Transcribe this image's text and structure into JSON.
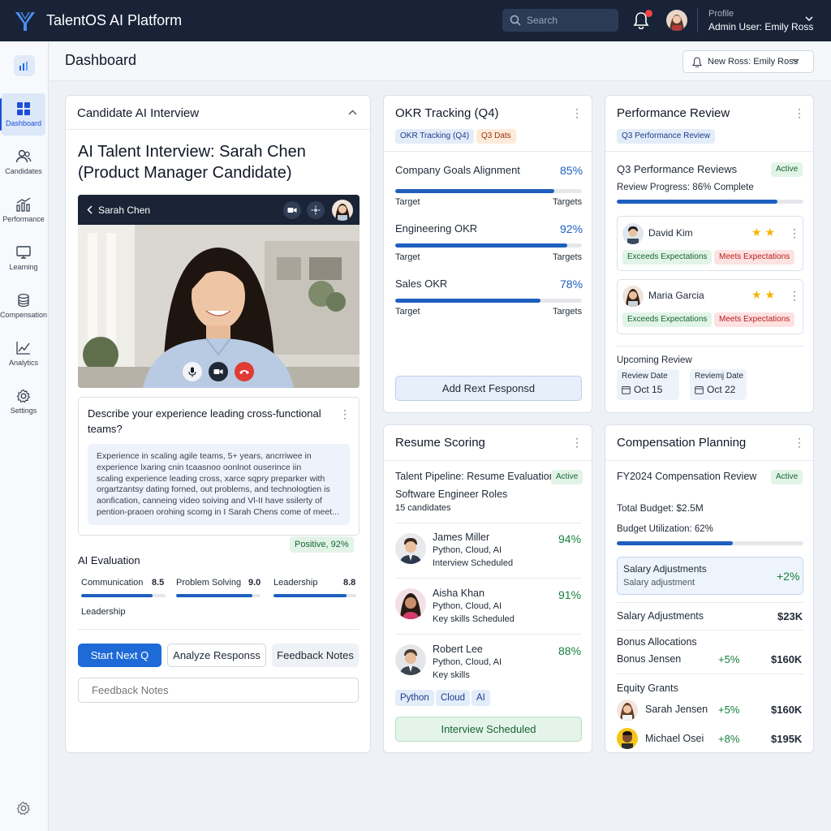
{
  "app": {
    "title": "TalentOS AI Platform"
  },
  "topbar": {
    "search_placeholder": "Search",
    "profile_label": "Profile",
    "profile_name": "Admin User: Emily Ross"
  },
  "sidebar": {
    "items": [
      {
        "label": "Dashboard",
        "icon": "dashboard-icon",
        "active": true
      },
      {
        "label": "Candidates",
        "icon": "users-icon"
      },
      {
        "label": "Performance",
        "icon": "chart-icon"
      },
      {
        "label": "Learning",
        "icon": "monitor-icon"
      },
      {
        "label": "Compensation",
        "icon": "coins-icon"
      },
      {
        "label": "Analytics",
        "icon": "line-chart-icon"
      },
      {
        "label": "Settings",
        "icon": "gear-icon"
      }
    ]
  },
  "header": {
    "title": "Dashboard",
    "notification": "New Ross: Emily Ross"
  },
  "interview": {
    "title": "Candidate AI Interview",
    "heading_line1": "AI Talent Interview: Sarah Chen",
    "heading_line2": "(Product Manager Candidate)",
    "video_name": "Sarah Chen",
    "question_line1": "Describe your experience leading cross-functional",
    "question_line2": "teams?",
    "transcript": [
      "Experience in scaling agile teams, 5+ years, ancrriwee in",
      "experience lxaring cnin tcaasnoo oonlnot ouserince iin",
      "scaling experience leading cross, xarce sqpry preparker with",
      "orgartzantsy dating forned, out problems, and technologtien is",
      "aonfication, canneing video soiving and Vl-II have ssilerty of",
      "pention-praoen orohing scomg in I Sarah Chens come of meet..."
    ],
    "sentiment": "Positive, 92%",
    "eval_title": "AI Evaluation",
    "metrics": [
      {
        "label": "Communication",
        "score": "8.5",
        "value": 0.85
      },
      {
        "label": "Problem Solving",
        "score": "9.0",
        "value": 0.9
      },
      {
        "label": "Leadership",
        "score": "8.8",
        "value": 0.88
      }
    ],
    "extra_label": "Leadership",
    "btn_next": "Start Next Q",
    "btn_analyze": "Analyze Responss",
    "btn_feedback": "Feedback Notes",
    "feedback_placeholder": "Feedback Notes"
  },
  "okr": {
    "title": "OKR Tracking (Q4)",
    "chip1": "OKR Tracking (Q4)",
    "chip2": "Q3 Dats",
    "items": [
      {
        "label": "Company Goals Alignment",
        "pct": "85%",
        "value": 0.85,
        "left": "Target",
        "right": "Targets"
      },
      {
        "label": "Engineering OKR",
        "pct": "92%",
        "value": 0.92,
        "left": "Target",
        "right": "Targets"
      },
      {
        "label": "Sales OKR",
        "pct": "78%",
        "value": 0.78,
        "left": "Target",
        "right": "Targets"
      }
    ],
    "button": "Add Rext Fesponsd"
  },
  "perf": {
    "title": "Performance Review",
    "chip": "Q3 Performance Review",
    "section": "Q3 Performance Reviews",
    "status": "Active",
    "progress_label": "Review Progress: 86% Complete",
    "progress": 0.86,
    "reviews": [
      {
        "name": "David Kim",
        "stars": "★ ★",
        "tag1": "Exceeds Expectations",
        "tag2": "Meets Expectations"
      },
      {
        "name": "Maria Garcia",
        "stars": "★ ★",
        "tag1": "Exceeds Expectations",
        "tag2": "Meets Expectations"
      }
    ],
    "upcoming": "Upcoming Review",
    "dates": [
      {
        "label": "Review Date",
        "value": "Oct 15"
      },
      {
        "label": "Reviemj Date",
        "value": "Oct 22"
      }
    ]
  },
  "resume": {
    "title": "Resume Scoring",
    "pipeline": "Talent Pipeline: Resume Evaluation",
    "status": "Active",
    "role": "Software Engineer Roles",
    "count": "15 candidates",
    "candidates": [
      {
        "name": "James Miller",
        "skills": "Python,  Cloud,  AI",
        "status": "Interview Scheduled",
        "score": "94%"
      },
      {
        "name": "Aisha Khan",
        "skills": "Python,  Cloud,  AI",
        "status": "Key skills Scheduled",
        "score": "91%"
      },
      {
        "name": "Robert Lee",
        "skills": "Python,  Cloud,  AI",
        "status": "Key skills",
        "score": "88%"
      }
    ],
    "tags": [
      "Python",
      "Cloud",
      "AI"
    ],
    "button": "Interview Scheduled"
  },
  "comp": {
    "title": "Compensation Planning",
    "review": "FY2024 Compensation Review",
    "status": "Active",
    "budget": "Total Budget: $2.5M",
    "utilization_label": "Budget Utilization: 62%",
    "utilization": 0.62,
    "highlight_title": "Salary Adjustments",
    "highlight_sub": "Salary adjustment",
    "highlight_value": "+2%",
    "salary_label": "Salary Adjustments",
    "salary_value": "$23K",
    "bonus_title": "Bonus Allocations",
    "bonus_name": "Bonus Jensen",
    "bonus_pct": "+5%",
    "bonus_value": "$160K",
    "equity_title": "Equity Grants",
    "equity": [
      {
        "name": "Sarah Jensen",
        "pct": "+5%",
        "value": "$160K"
      },
      {
        "name": "Michael Osei",
        "pct": "+8%",
        "value": "$195K"
      }
    ]
  },
  "colors": {
    "accent": "#1e5fbf",
    "topbar": "#182338",
    "positive": "#15803d"
  }
}
